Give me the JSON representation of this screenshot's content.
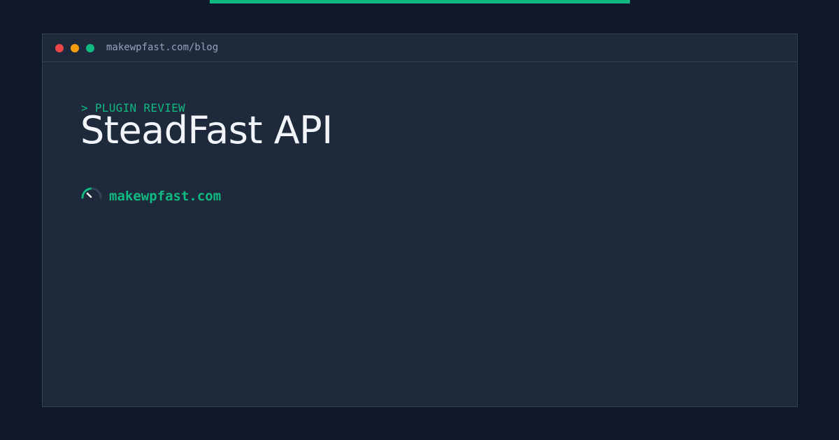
{
  "accent_color": "#10b981",
  "browser": {
    "url": "makewpfast.com/blog",
    "buttons": [
      "close",
      "minimize",
      "zoom"
    ]
  },
  "post": {
    "category": "> PLUGIN REVIEW",
    "title": "SteadFast API"
  },
  "brand": {
    "icon": "speedometer-icon",
    "name": "makewpfast.com"
  }
}
